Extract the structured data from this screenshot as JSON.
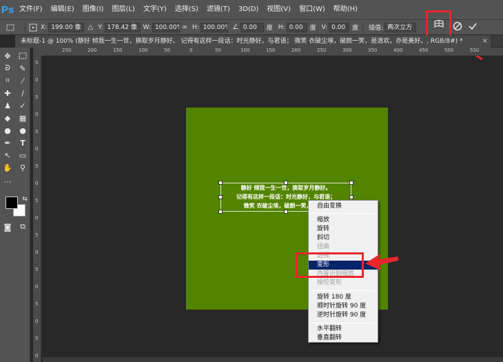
{
  "app": {
    "logo": "Ps"
  },
  "menubar": {
    "items": [
      "文件(F)",
      "编辑(E)",
      "图像(I)",
      "图层(L)",
      "文字(Y)",
      "选择(S)",
      "滤镜(T)",
      "3D(D)",
      "视图(V)",
      "窗口(W)",
      "帮助(H)"
    ]
  },
  "options": {
    "x_label": "X:",
    "x_value": "199.00 像 ...",
    "y_label": "Y:",
    "y_value": "178.42 像 ...",
    "w_label": "W:",
    "w_value": "100.00%",
    "h_label": "H:",
    "h_value": "100.00%",
    "angle_value": "0.00",
    "angle_unit": "度",
    "hskew_label": "H:",
    "hskew_value": "0.00",
    "hskew_unit": "度",
    "vskew_label": "V:",
    "vskew_value": "0.00",
    "vskew_unit": "度",
    "interp_label": "插值:",
    "interp_value": "两次立方"
  },
  "tab": {
    "title": "未标题-1 @ 100% (静好 倾我一生一世，换取岁月静好。 记得有这样一段话：时光静好，与君语； 微笑 衣破尘埃，破颜一笑，是清欢，亦是美好。, RGB/8#) *",
    "close": "×"
  },
  "ruler": {
    "h_ticks": [
      "250",
      "200",
      "150",
      "100",
      "50",
      "0",
      "50",
      "100",
      "150",
      "200",
      "250",
      "300",
      "350",
      "400",
      "450",
      "500",
      "550"
    ],
    "v_ticks": [
      "5",
      "0",
      "5",
      "0",
      "5",
      "0",
      "5",
      "0",
      "5",
      "0",
      "5",
      "0",
      "5",
      "0",
      "5",
      "0",
      "5",
      "0"
    ]
  },
  "canvas": {
    "lines": [
      "静好 倾我一生一世，换取岁月静好。",
      "记得有这样一段话：时光静好，与君语；",
      "微笑 衣破尘埃，破颜一笑，是清欢"
    ]
  },
  "context_menu": {
    "items": [
      {
        "label": "自由变换",
        "state": "normal"
      },
      {
        "label": "缩放",
        "state": "normal"
      },
      {
        "label": "旋转",
        "state": "normal"
      },
      {
        "label": "斜切",
        "state": "normal"
      },
      {
        "label": "扭曲",
        "state": "disabled"
      },
      {
        "label": "透视",
        "state": "disabled"
      },
      {
        "label": "变形",
        "state": "selected"
      },
      {
        "label": "内容识别缩放",
        "state": "disabled"
      },
      {
        "label": "操控变形",
        "state": "disabled"
      },
      {
        "label": "旋转 180 度",
        "state": "normal"
      },
      {
        "label": "顺时针旋转 90 度",
        "state": "normal"
      },
      {
        "label": "逆时针旋转 90 度",
        "state": "normal"
      },
      {
        "label": "水平翻转",
        "state": "normal"
      },
      {
        "label": "垂直翻转",
        "state": "normal"
      }
    ]
  },
  "colors": {
    "canvas": "#538400",
    "highlight": "#e8262b",
    "selected": "#0a246a"
  }
}
